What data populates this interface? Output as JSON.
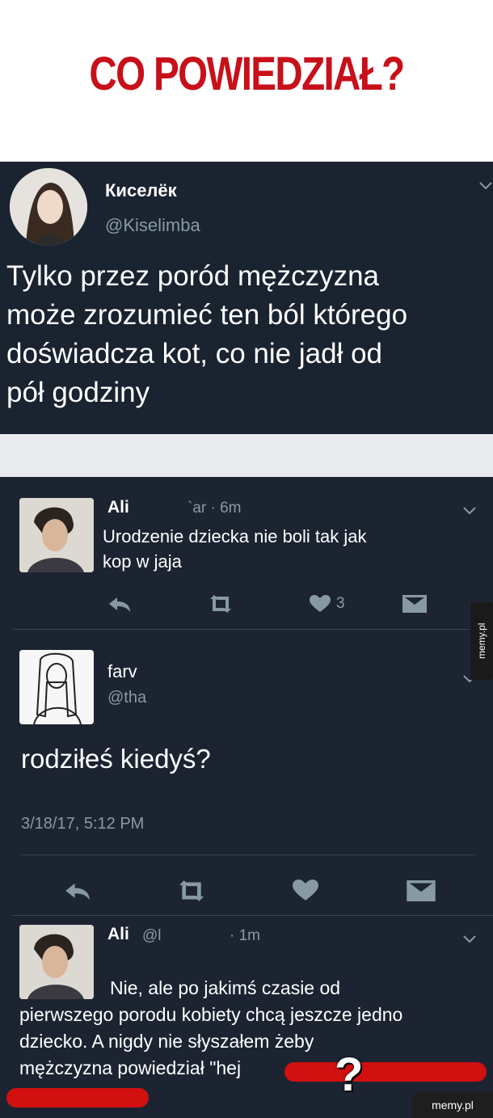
{
  "headline": "CO POWIEDZIAŁ?",
  "tweet1": {
    "name": "Киселёк",
    "handle": "@Kiselimba",
    "text_lines": [
      "Tylko przez poród mężczyzna",
      "może zrozumieć ten ból którego",
      "doświadcza kot, co nie jadł od",
      "pół godziny"
    ]
  },
  "reply1": {
    "name": "Ali",
    "meta": "`ar · 6m",
    "text_lines": [
      "Urodzenie dziecka nie boli tak jak",
      "kop w jaja"
    ],
    "like_count": "3"
  },
  "tweet2": {
    "name": "farv",
    "handle": "@tha",
    "text": "rodziłeś kiedyś?",
    "timestamp": "3/18/17, 5:12 PM"
  },
  "reply2": {
    "name": "Ali",
    "meta": "@l",
    "time": "· 1m",
    "text_lines": [
      "Nie, ale po jakimś czasie od",
      "pierwszego porodu kobiety chcą jeszcze jedno",
      "dziecko. A nigdy nie słyszałem żeby",
      "mężczyzna powiedział \"hej"
    ]
  },
  "overlay": {
    "question_mark": "?"
  },
  "watermarks": {
    "side": "memy.pl",
    "corner": "memy.pl"
  },
  "colors": {
    "headline": "#c8101a",
    "panel": "#1a2330",
    "redact": "#d11010"
  },
  "icons": [
    "chevron-down-icon",
    "reply-icon",
    "retweet-icon",
    "heart-icon",
    "dm-icon"
  ]
}
